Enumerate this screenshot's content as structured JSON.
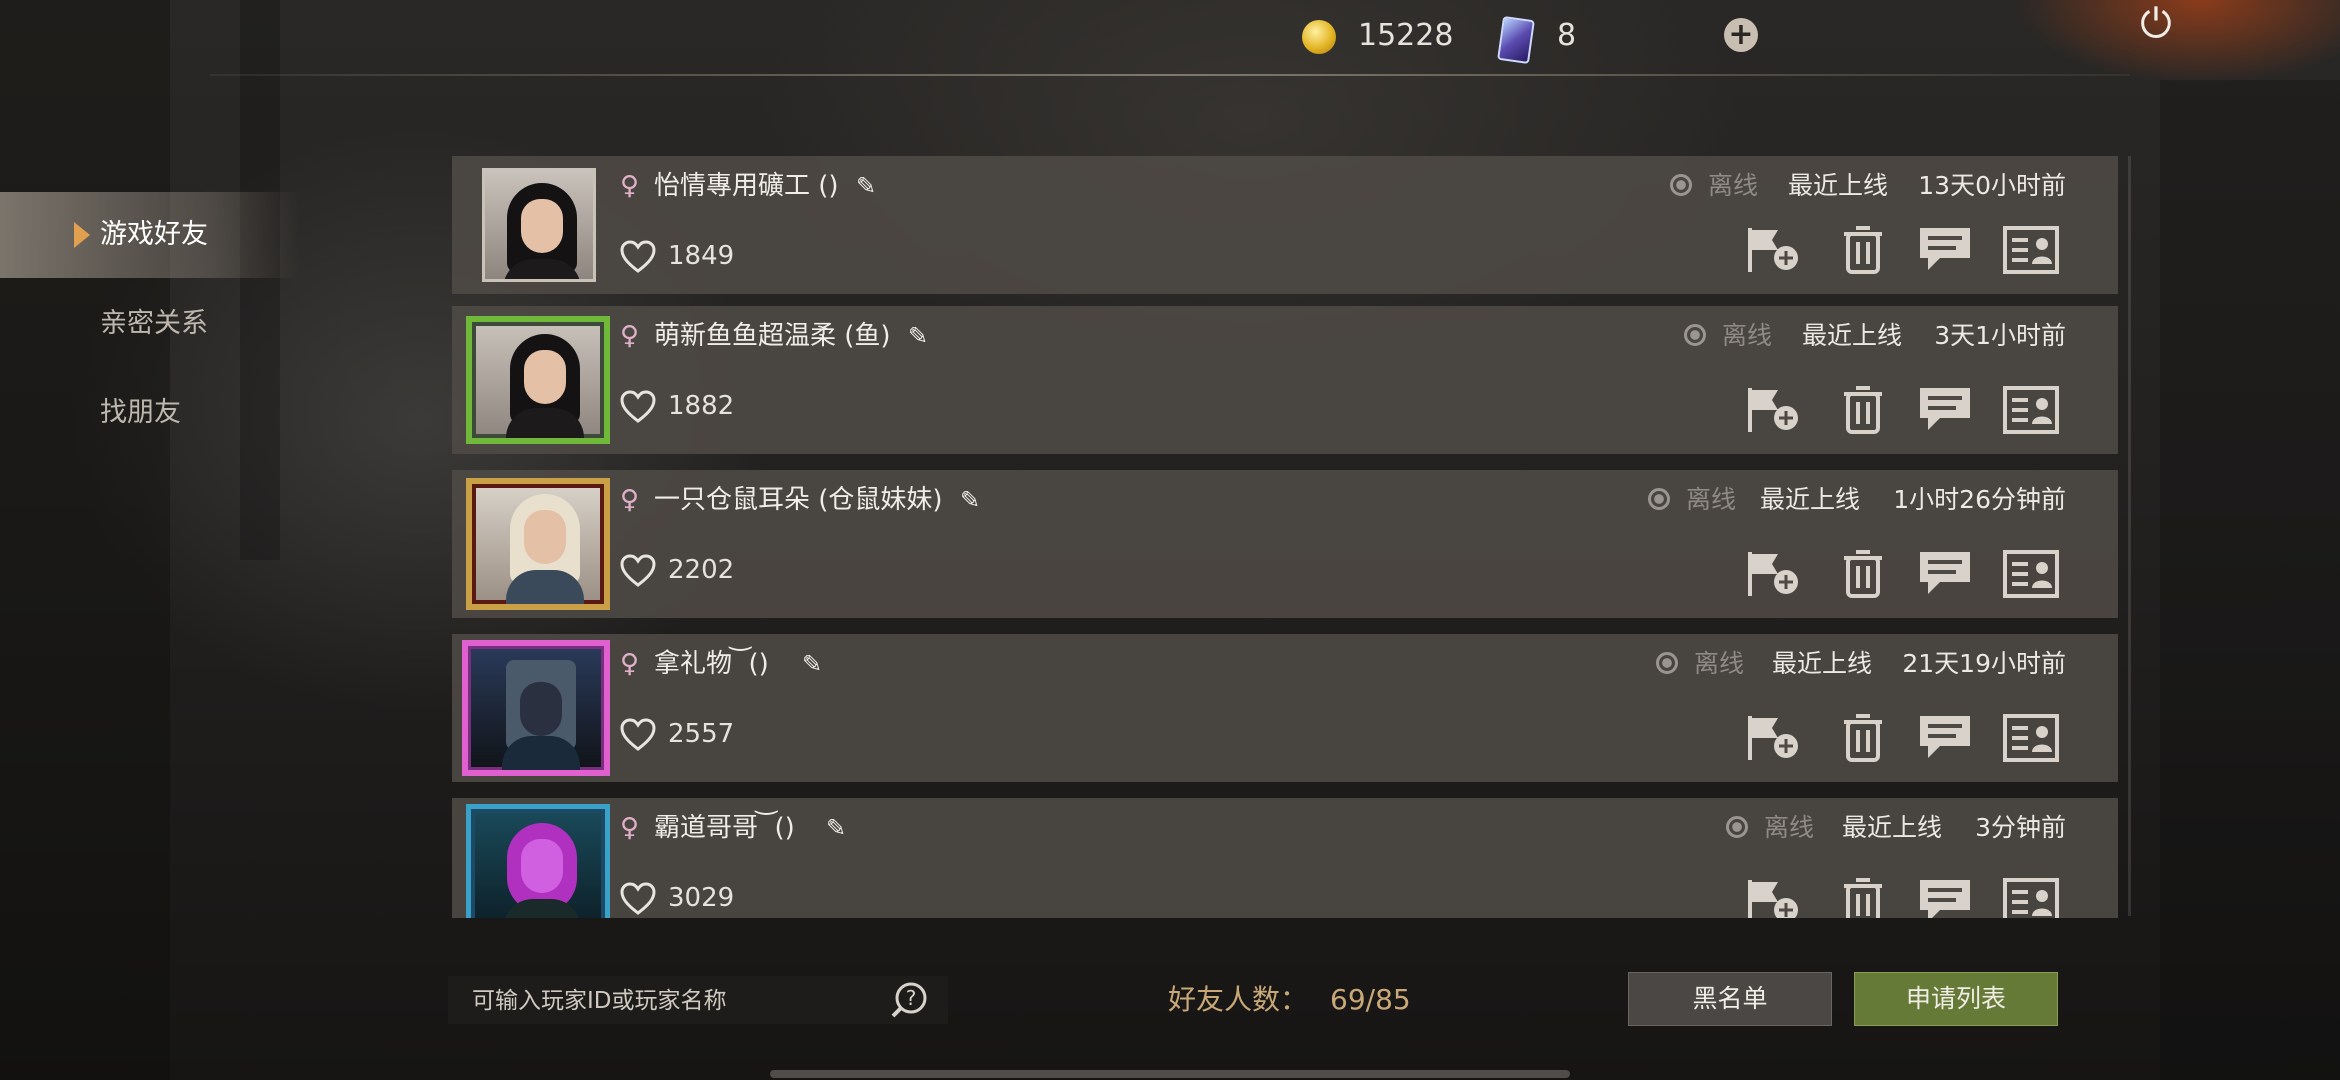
{
  "currency": {
    "coins": "15228",
    "cards": "8"
  },
  "sidebar": {
    "items": [
      {
        "label": "游戏好友",
        "active": true
      },
      {
        "label": "亲密关系",
        "active": false
      },
      {
        "label": "找朋友",
        "active": false
      }
    ]
  },
  "friends": [
    {
      "name": "怡情專用礦工 ()",
      "likes": "1849",
      "status": "离线",
      "last_label": "最近上线",
      "last_time": "13天0小时前",
      "frame": "none"
    },
    {
      "name": "萌新鱼鱼超温柔 (鱼)",
      "likes": "1882",
      "status": "离线",
      "last_label": "最近上线",
      "last_time": "3天1小时前",
      "frame": "green"
    },
    {
      "name": "一只仓鼠耳朵 (仓鼠妹妹)",
      "likes": "2202",
      "status": "离线",
      "last_label": "最近上线",
      "last_time": "1小时26分钟前",
      "frame": "gold"
    },
    {
      "name": "拿礼物 ͝ ()",
      "likes": "2557",
      "status": "离线",
      "last_label": "最近上线",
      "last_time": "21天19小时前",
      "frame": "pink"
    },
    {
      "name": "霸道哥哥 ͝ ()",
      "likes": "3029",
      "status": "离线",
      "last_label": "最近上线",
      "last_time": "3分钟前",
      "frame": "blue"
    }
  ],
  "search": {
    "placeholder": "可输入玩家ID或玩家名称"
  },
  "friend_count": {
    "label": "好友人数：",
    "value": "69/85"
  },
  "buttons": {
    "blacklist": "黑名单",
    "apply_list": "申请列表"
  },
  "icons": [
    "coin-icon",
    "card-icon",
    "plus-icon",
    "power-icon",
    "female-icon",
    "edit-icon",
    "heart-icon",
    "flag-add-icon",
    "trash-icon",
    "chat-icon",
    "profile-card-icon",
    "help-search-icon"
  ]
}
